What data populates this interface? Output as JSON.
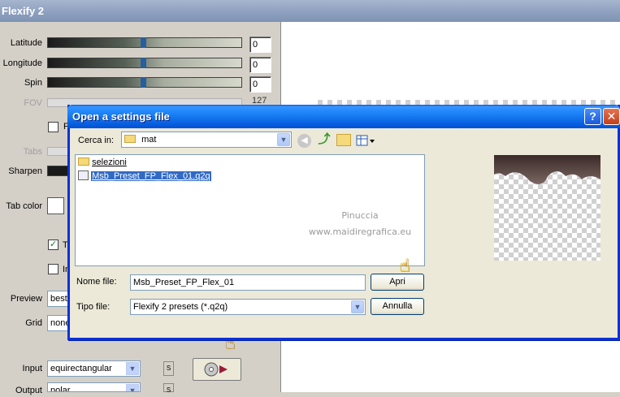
{
  "main_window": {
    "title": "Flexify 2"
  },
  "controls": {
    "latitude": {
      "label": "Latitude",
      "value": "0",
      "level": 0.5
    },
    "longitude": {
      "label": "Longitude",
      "value": "0",
      "level": 0.5
    },
    "spin": {
      "label": "Spin",
      "value": "0",
      "level": 0.5
    },
    "fov": {
      "label": "FOV",
      "value": "127"
    },
    "checkbox_f_label": "F",
    "tabs_label": "Tabs",
    "sharpen_label": "Sharpen",
    "tab_color_label": "Tab color",
    "checkbox_t_label": "T",
    "checkbox_t_checked": true,
    "checkbox_i_label": "In",
    "preview_label": "Preview",
    "preview_value": "best",
    "grid_label": "Grid",
    "grid_value": "none",
    "input_label": "Input",
    "input_value": "equirectangular",
    "output_label": "Output",
    "output_value": "polar",
    "s_button": "S"
  },
  "dialog": {
    "title": "Open a settings file",
    "help_button": "?",
    "close_button": "✕",
    "look_in_label": "Cerca in:",
    "look_in_value": "mat",
    "files": [
      {
        "name": "selezioni",
        "type": "folder",
        "selected": false
      },
      {
        "name": "Msb_Preset_FP_Flex_01.q2q",
        "type": "file",
        "selected": true
      }
    ],
    "watermark_line1": "Pinuccia",
    "watermark_line2": "www.maidiregrafica.eu",
    "filename_label": "Nome file:",
    "filename_value": "Msb_Preset_FP_Flex_01",
    "filetype_label": "Tipo file:",
    "filetype_value": "Flexify 2 presets (*.q2q)",
    "open_button": "Apri",
    "cancel_button": "Annulla"
  },
  "colors": {
    "xp_title_blue": "#0a5ddd",
    "panel_gray": "#d4d0c8",
    "dialog_beige": "#ece9d8",
    "selection_blue": "#316ac5"
  }
}
